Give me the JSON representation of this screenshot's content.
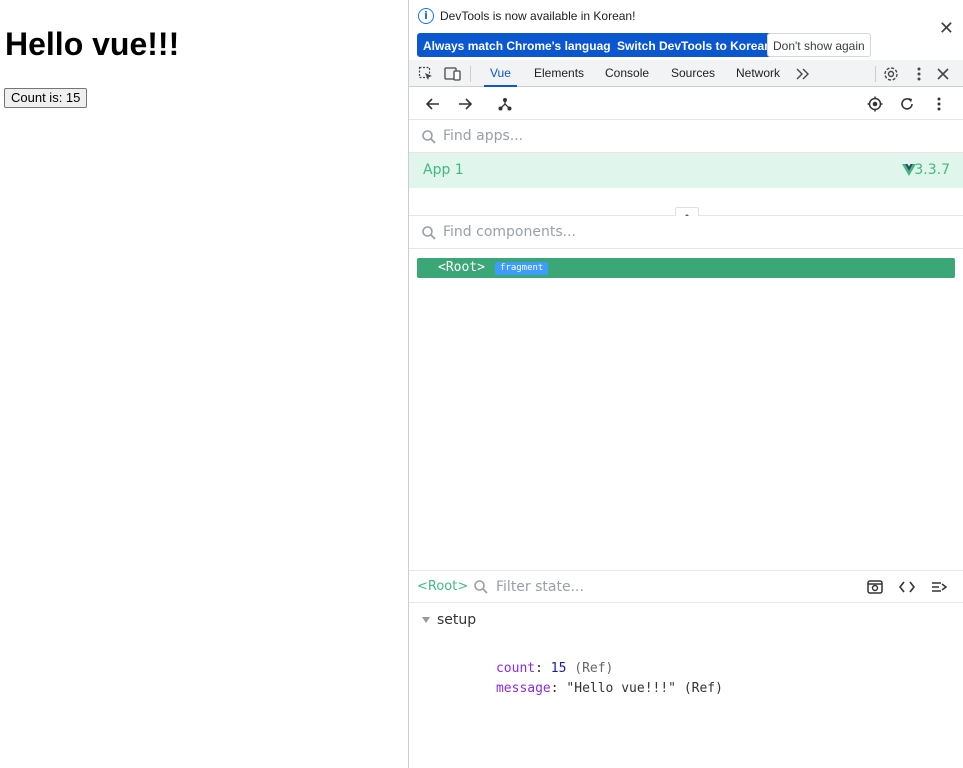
{
  "page": {
    "heading": "Hello vue!!!",
    "counter_button": "Count is: 15"
  },
  "infobar": {
    "message": "DevTools is now available in Korean!",
    "btn_match": "Always match Chrome's language",
    "btn_switch": "Switch DevTools to Korean",
    "btn_dismiss": "Don't show again"
  },
  "tabs": {
    "vue": "Vue",
    "elements": "Elements",
    "console": "Console",
    "sources": "Sources",
    "network": "Network"
  },
  "apps": {
    "search_placeholder": "Find apps...",
    "app_name": "App 1",
    "version": "3.3.7"
  },
  "components": {
    "search_placeholder": "Find components...",
    "root_tag": "<Root>",
    "badge": "fragment"
  },
  "state": {
    "component": "<Root>",
    "filter_placeholder": "Filter state...",
    "section": "setup",
    "rows": [
      {
        "key": "count",
        "value": "15",
        "type": "(Ref)"
      },
      {
        "key": "message",
        "value": "\"Hello vue!!!\"",
        "type": "(Ref)"
      }
    ]
  },
  "colors": {
    "vue_green": "#42b883",
    "tab_active": "#0b57d0",
    "primary_button": "#0b57d0",
    "selected_node": "#3ba776"
  }
}
